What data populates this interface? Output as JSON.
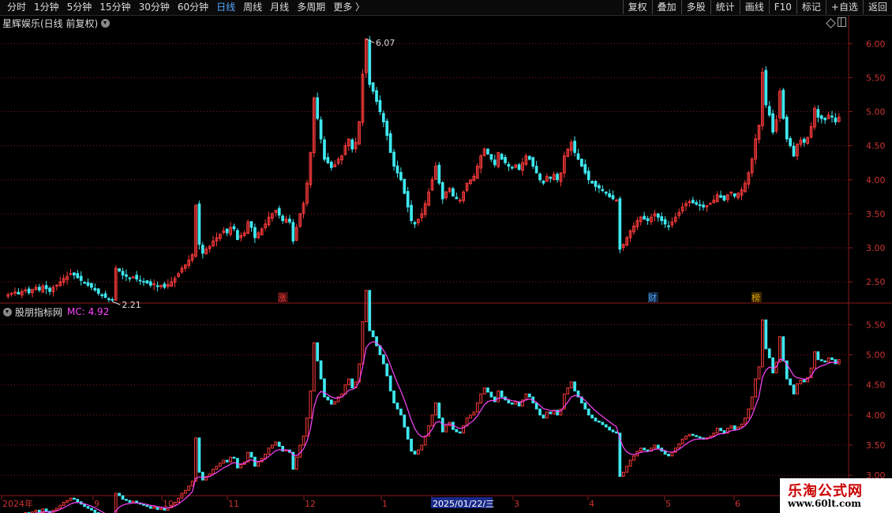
{
  "toolbar": {
    "periods": [
      "分时",
      "1分钟",
      "5分钟",
      "15分钟",
      "30分钟",
      "60分钟",
      "日线",
      "周线",
      "月线",
      "多周期",
      "更多 〉"
    ],
    "active_period": "日线",
    "right_buttons": [
      "复权",
      "叠加",
      "多股",
      "统计",
      "画线",
      "F10",
      "标记",
      "+自选",
      "返回"
    ]
  },
  "main_title": "星辉娱乐(日线 前复权)",
  "indicator_title": "股朋指标网",
  "mc_label": "MC: 4.92",
  "watermark": {
    "line1": "乐淘公式网",
    "line2": "www.60lt.com"
  },
  "colors": {
    "up": "#ff3b3b",
    "down": "#3ee8f0",
    "mc_line": "#ff44ff",
    "grid": "#8b1a1a",
    "axis_text": "#cc3333"
  },
  "chart_data": [
    {
      "type": "candlestick",
      "title": "星辉娱乐(日线 前复权)",
      "ylim": [
        2.2,
        6.2
      ],
      "y_ticks": [
        2.5,
        3.0,
        3.5,
        4.0,
        4.5,
        5.0,
        5.5,
        6.0
      ],
      "y_tick_labels": [
        "2.50",
        "3.00",
        "3.50",
        "4.00",
        "4.50",
        "5.00",
        "5.50",
        "6.00"
      ],
      "annotations": [
        {
          "text": "6.07",
          "value": 6.07
        },
        {
          "text": "2.21",
          "value": 2.21
        }
      ],
      "event_markers": [
        "涨",
        "财",
        "榜"
      ],
      "closes": [
        2.31,
        2.33,
        2.35,
        2.32,
        2.36,
        2.38,
        2.34,
        2.39,
        2.42,
        2.38,
        2.44,
        2.4,
        2.36,
        2.42,
        2.45,
        2.5,
        2.55,
        2.58,
        2.62,
        2.6,
        2.56,
        2.52,
        2.48,
        2.45,
        2.42,
        2.38,
        2.33,
        2.3,
        2.27,
        2.25,
        2.23,
        2.7,
        2.66,
        2.6,
        2.58,
        2.55,
        2.57,
        2.54,
        2.52,
        2.5,
        2.48,
        2.45,
        2.47,
        2.43,
        2.45,
        2.42,
        2.46,
        2.5,
        2.55,
        2.62,
        2.7,
        2.75,
        2.82,
        2.9,
        3.62,
        3.05,
        2.92,
        2.98,
        3.02,
        3.1,
        3.15,
        3.2,
        3.25,
        3.22,
        3.3,
        3.28,
        3.12,
        3.18,
        3.22,
        3.38,
        3.3,
        3.15,
        3.22,
        3.28,
        3.35,
        3.45,
        3.5,
        3.55,
        3.48,
        3.4,
        3.42,
        3.38,
        3.1,
        3.3,
        3.5,
        3.65,
        3.95,
        4.4,
        5.2,
        4.9,
        4.6,
        4.3,
        4.25,
        4.18,
        4.22,
        4.3,
        4.35,
        4.5,
        4.6,
        4.45,
        4.55,
        4.85,
        5.55,
        6.07,
        5.4,
        5.3,
        5.15,
        5.0,
        4.85,
        4.65,
        4.4,
        4.2,
        4.1,
        4.0,
        3.8,
        3.6,
        3.4,
        3.35,
        3.42,
        3.5,
        3.65,
        3.82,
        4.0,
        4.2,
        3.95,
        3.72,
        3.82,
        3.88,
        3.76,
        3.72,
        3.7,
        3.82,
        3.95,
        4.0,
        4.05,
        4.2,
        4.35,
        4.45,
        4.38,
        4.3,
        4.22,
        4.4,
        4.3,
        4.25,
        4.2,
        4.18,
        4.22,
        4.15,
        4.25,
        4.35,
        4.3,
        4.2,
        4.1,
        4.0,
        3.95,
        4.05,
        4.02,
        4.08,
        4.0,
        4.1,
        4.35,
        4.45,
        4.55,
        4.4,
        4.3,
        4.2,
        4.1,
        4.0,
        3.95,
        3.9,
        3.88,
        3.84,
        3.8,
        3.75,
        3.72,
        3.7,
        2.98,
        3.05,
        3.15,
        3.25,
        3.32,
        3.4,
        3.45,
        3.42,
        3.4,
        3.45,
        3.5,
        3.45,
        3.4,
        3.35,
        3.32,
        3.38,
        3.45,
        3.52,
        3.6,
        3.65,
        3.68,
        3.66,
        3.64,
        3.62,
        3.6,
        3.62,
        3.65,
        3.7,
        3.78,
        3.74,
        3.7,
        3.78,
        3.82,
        3.76,
        3.8,
        3.85,
        3.95,
        4.1,
        4.3,
        4.6,
        4.8,
        5.58,
        5.1,
        4.95,
        4.7,
        4.88,
        5.3,
        4.9,
        4.6,
        4.5,
        4.35,
        4.52,
        4.58,
        4.55,
        4.62,
        4.78,
        5.05,
        4.92,
        4.9,
        4.88,
        4.95,
        4.92,
        4.85,
        4.92
      ]
    },
    {
      "type": "bar-indicator",
      "title": "股朋指标网",
      "series": [
        {
          "name": "MC",
          "last": 4.92
        }
      ],
      "ylim": [
        2.7,
        5.65
      ],
      "y_ticks": [
        3.0,
        3.5,
        4.0,
        4.5,
        5.0,
        5.5
      ],
      "y_tick_labels": [
        "3.00",
        "3.50",
        "4.00",
        "4.50",
        "5.00",
        "5.50"
      ]
    }
  ],
  "x_axis_labels": [
    "2024年",
    "9",
    "10",
    "11",
    "12",
    "1",
    "2025/01/22/三",
    "3",
    "4",
    "5",
    "6"
  ],
  "x_label_highlight": "2025/01/22/三"
}
